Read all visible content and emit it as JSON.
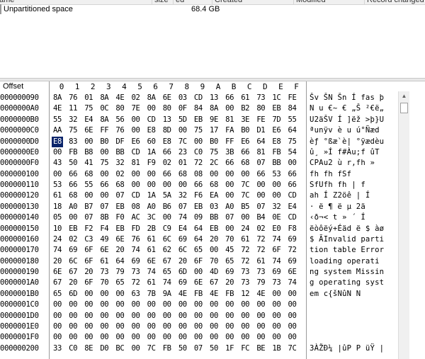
{
  "list": {
    "columns": [
      "ame",
      "size",
      "ed",
      "Created",
      "Modified",
      "Record changed"
    ],
    "rows": [
      {
        "name": "Unpartitioned space",
        "size": "68.4 GB"
      }
    ]
  },
  "hex": {
    "offset_label": "Offset",
    "columns": [
      "0",
      "1",
      "2",
      "3",
      "4",
      "5",
      "6",
      "7",
      "8",
      "9",
      "A",
      "B",
      "C",
      "D",
      "E",
      "F"
    ],
    "selected": {
      "row": 4,
      "col": 0
    },
    "rows": [
      {
        "offset": "000000090",
        "bytes": [
          "8A",
          "76",
          "01",
          "8A",
          "4E",
          "02",
          "8A",
          "6E",
          "03",
          "CD",
          "13",
          "66",
          "61",
          "73",
          "1C",
          "FE"
        ],
        "ascii": "Šv ŠN Šn Í fas þ"
      },
      {
        "offset": "0000000A0",
        "bytes": [
          "4E",
          "11",
          "75",
          "0C",
          "80",
          "7E",
          "00",
          "80",
          "0F",
          "84",
          "8A",
          "00",
          "B2",
          "80",
          "EB",
          "84"
        ],
        "ascii": "N u €~ € „Š ²€ë„"
      },
      {
        "offset": "0000000B0",
        "bytes": [
          "55",
          "32",
          "E4",
          "8A",
          "56",
          "00",
          "CD",
          "13",
          "5D",
          "EB",
          "9E",
          "81",
          "3E",
          "FE",
          "7D",
          "55"
        ],
        "ascii": "U2äŠV Í ]ëž >þ}U"
      },
      {
        "offset": "0000000C0",
        "bytes": [
          "AA",
          "75",
          "6E",
          "FF",
          "76",
          "00",
          "E8",
          "8D",
          "00",
          "75",
          "17",
          "FA",
          "B0",
          "D1",
          "E6",
          "64"
        ],
        "ascii": "ªunÿv è  u ú°Ñæd"
      },
      {
        "offset": "0000000D0",
        "bytes": [
          "E8",
          "83",
          "00",
          "B0",
          "DF",
          "E6",
          "60",
          "E8",
          "7C",
          "00",
          "B0",
          "FF",
          "E6",
          "64",
          "E8",
          "75"
        ],
        "ascii": "èƒ °ßæ`è| °ÿædèu"
      },
      {
        "offset": "0000000E0",
        "bytes": [
          "00",
          "FB",
          "B8",
          "00",
          "BB",
          "CD",
          "1A",
          "66",
          "23",
          "C0",
          "75",
          "3B",
          "66",
          "81",
          "FB",
          "54"
        ],
        "ascii": " û¸ »Í f#Àu;f ûT"
      },
      {
        "offset": "0000000F0",
        "bytes": [
          "43",
          "50",
          "41",
          "75",
          "32",
          "81",
          "F9",
          "02",
          "01",
          "72",
          "2C",
          "66",
          "68",
          "07",
          "BB",
          "00"
        ],
        "ascii": "CPAu2 ù  r,fh »"
      },
      {
        "offset": "000000100",
        "bytes": [
          "00",
          "66",
          "68",
          "00",
          "02",
          "00",
          "00",
          "66",
          "68",
          "08",
          "00",
          "00",
          "00",
          "66",
          "53",
          "66"
        ],
        "ascii": " fh     fh   fSf"
      },
      {
        "offset": "000000110",
        "bytes": [
          "53",
          "66",
          "55",
          "66",
          "68",
          "00",
          "00",
          "00",
          "00",
          "66",
          "68",
          "00",
          "7C",
          "00",
          "00",
          "66"
        ],
        "ascii": "SfUfh    fh |  f"
      },
      {
        "offset": "000000120",
        "bytes": [
          "61",
          "68",
          "00",
          "00",
          "07",
          "CD",
          "1A",
          "5A",
          "32",
          "F6",
          "EA",
          "00",
          "7C",
          "00",
          "00",
          "CD"
        ],
        "ascii": "ah   Í Z2öê |  Í"
      },
      {
        "offset": "000000130",
        "bytes": [
          "18",
          "A0",
          "B7",
          "07",
          "EB",
          "08",
          "A0",
          "B6",
          "07",
          "EB",
          "03",
          "A0",
          "B5",
          "07",
          "32",
          "E4"
        ],
        "ascii": "  · ë  ¶ ë  µ 2ä"
      },
      {
        "offset": "000000140",
        "bytes": [
          "05",
          "00",
          "07",
          "8B",
          "F0",
          "AC",
          "3C",
          "00",
          "74",
          "09",
          "BB",
          "07",
          "00",
          "B4",
          "0E",
          "CD"
        ],
        "ascii": "   ‹ð¬< t »  ´ Í"
      },
      {
        "offset": "000000150",
        "bytes": [
          "10",
          "EB",
          "F2",
          "F4",
          "EB",
          "FD",
          "2B",
          "C9",
          "E4",
          "64",
          "EB",
          "00",
          "24",
          "02",
          "E0",
          "F8"
        ],
        "ascii": " ëòôëý+Éäd ë $ àø"
      },
      {
        "offset": "000000160",
        "bytes": [
          "24",
          "02",
          "C3",
          "49",
          "6E",
          "76",
          "61",
          "6C",
          "69",
          "64",
          "20",
          "70",
          "61",
          "72",
          "74",
          "69"
        ],
        "ascii": "$ ÃInvalid parti"
      },
      {
        "offset": "000000170",
        "bytes": [
          "74",
          "69",
          "6F",
          "6E",
          "20",
          "74",
          "61",
          "62",
          "6C",
          "65",
          "00",
          "45",
          "72",
          "72",
          "6F",
          "72"
        ],
        "ascii": "tion table Error"
      },
      {
        "offset": "000000180",
        "bytes": [
          "20",
          "6C",
          "6F",
          "61",
          "64",
          "69",
          "6E",
          "67",
          "20",
          "6F",
          "70",
          "65",
          "72",
          "61",
          "74",
          "69"
        ],
        "ascii": " loading operati"
      },
      {
        "offset": "000000190",
        "bytes": [
          "6E",
          "67",
          "20",
          "73",
          "79",
          "73",
          "74",
          "65",
          "6D",
          "00",
          "4D",
          "69",
          "73",
          "73",
          "69",
          "6E"
        ],
        "ascii": "ng system Missin"
      },
      {
        "offset": "0000001A0",
        "bytes": [
          "67",
          "20",
          "6F",
          "70",
          "65",
          "72",
          "61",
          "74",
          "69",
          "6E",
          "67",
          "20",
          "73",
          "79",
          "73",
          "74"
        ],
        "ascii": "g operating syst"
      },
      {
        "offset": "0000001B0",
        "bytes": [
          "65",
          "6D",
          "00",
          "00",
          "00",
          "63",
          "7B",
          "9A",
          "4E",
          "FB",
          "4E",
          "FB",
          "12",
          "4E",
          "00",
          "00"
        ],
        "ascii": "em   c{šNûN N"
      },
      {
        "offset": "0000001C0",
        "bytes": [
          "00",
          "00",
          "00",
          "00",
          "00",
          "00",
          "00",
          "00",
          "00",
          "00",
          "00",
          "00",
          "00",
          "00",
          "00",
          "00"
        ],
        "ascii": ""
      },
      {
        "offset": "0000001D0",
        "bytes": [
          "00",
          "00",
          "00",
          "00",
          "00",
          "00",
          "00",
          "00",
          "00",
          "00",
          "00",
          "00",
          "00",
          "00",
          "00",
          "00"
        ],
        "ascii": ""
      },
      {
        "offset": "0000001E0",
        "bytes": [
          "00",
          "00",
          "00",
          "00",
          "00",
          "00",
          "00",
          "00",
          "00",
          "00",
          "00",
          "00",
          "00",
          "00",
          "00",
          "00"
        ],
        "ascii": ""
      },
      {
        "offset": "0000001F0",
        "bytes": [
          "00",
          "00",
          "00",
          "00",
          "00",
          "00",
          "00",
          "00",
          "00",
          "00",
          "00",
          "00",
          "00",
          "00",
          "00",
          "00"
        ],
        "ascii": ""
      },
      {
        "offset": "000000200",
        "bytes": [
          "33",
          "C0",
          "8E",
          "D0",
          "BC",
          "00",
          "7C",
          "FB",
          "50",
          "07",
          "50",
          "1F",
          "FC",
          "BE",
          "1B",
          "7C"
        ],
        "ascii": "3ÀŽÐ¼ |ûP P üŸ |"
      }
    ]
  }
}
